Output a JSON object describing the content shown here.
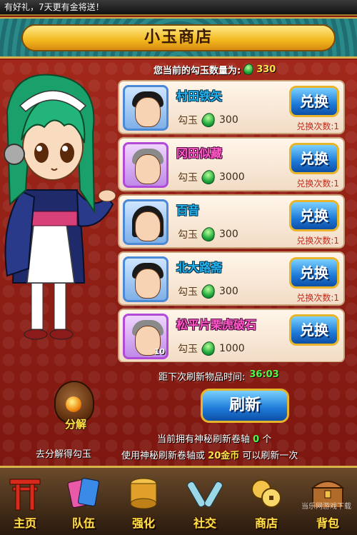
{
  "marquee": {
    "text": "有好礼，7天更有金将送！"
  },
  "title": "小玉商店",
  "gem_count": {
    "label": "您当前的勾玉数量为:",
    "value": "330"
  },
  "items": [
    {
      "name": "村田铁矢",
      "currency": "勾玉",
      "price": "300",
      "button": "兑换",
      "times": "兑换次数:1",
      "rarity": "blue",
      "hair": "black"
    },
    {
      "name": "冈田似藏",
      "currency": "勾玉",
      "price": "3000",
      "button": "兑换",
      "times": "兑换次数:1",
      "rarity": "purple",
      "hair": "grey"
    },
    {
      "name": "百音",
      "currency": "勾玉",
      "price": "300",
      "button": "兑换",
      "times": "兑换次数:1",
      "rarity": "blue",
      "hair": "long"
    },
    {
      "name": "北大路斋",
      "currency": "勾玉",
      "price": "300",
      "button": "兑换",
      "times": "兑换次数:1",
      "rarity": "blue",
      "hair": "black"
    },
    {
      "name": "松平片栗虎破石",
      "currency": "勾玉",
      "price": "1000",
      "button": "兑换",
      "times": "",
      "rarity": "purple",
      "hair": "grey",
      "badge": "10"
    }
  ],
  "refresh_timer": {
    "label": "距下次刷新物品时间:",
    "value": "36:03"
  },
  "refresh_button": "刷新",
  "info": {
    "line1_prefix": "当前拥有神秘刷新卷轴",
    "line1_count": "0",
    "line1_suffix": "个",
    "line2_prefix": "使用神秘刷新卷轴或",
    "line2_gold": "20金币",
    "line2_suffix": "可以刷新一次"
  },
  "decompose": {
    "label": "分解",
    "hint": "去分解得勾玉"
  },
  "nav": [
    {
      "label": "主页",
      "icon": "torii-gate-icon"
    },
    {
      "label": "队伍",
      "icon": "cards-icon"
    },
    {
      "label": "强化",
      "icon": "drum-icon"
    },
    {
      "label": "社交",
      "icon": "crossed-bottles-icon"
    },
    {
      "label": "商店",
      "icon": "coins-icon"
    },
    {
      "label": "背包",
      "icon": "chest-icon"
    }
  ],
  "watermark": "当乐网游戏下载",
  "colors": {
    "accent_gold": "#e8b42a",
    "gem_green": "#1ea63a",
    "name_blue": "#23b4f0",
    "name_purple": "#ff5ac8",
    "bg_red": "#a2281b"
  }
}
